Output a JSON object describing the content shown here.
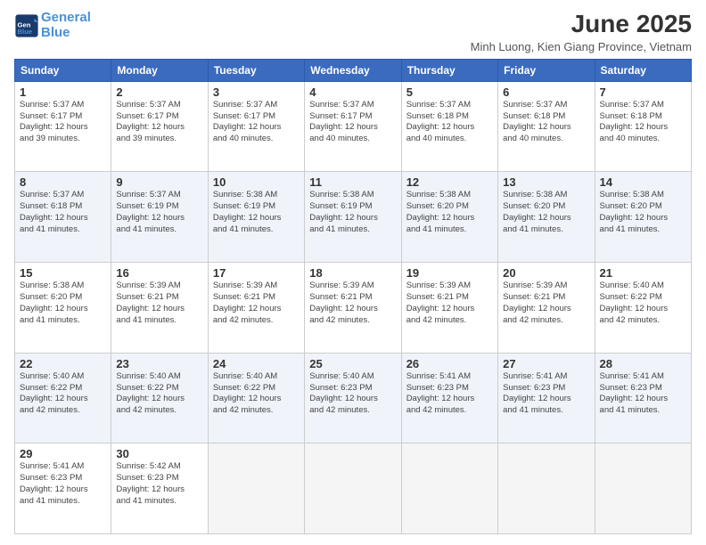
{
  "header": {
    "logo_line1": "General",
    "logo_line2": "Blue",
    "month_title": "June 2025",
    "location": "Minh Luong, Kien Giang Province, Vietnam"
  },
  "weekdays": [
    "Sunday",
    "Monday",
    "Tuesday",
    "Wednesday",
    "Thursday",
    "Friday",
    "Saturday"
  ],
  "weeks": [
    [
      {
        "day": 1,
        "info": "Sunrise: 5:37 AM\nSunset: 6:17 PM\nDaylight: 12 hours\nand 39 minutes."
      },
      {
        "day": 2,
        "info": "Sunrise: 5:37 AM\nSunset: 6:17 PM\nDaylight: 12 hours\nand 39 minutes."
      },
      {
        "day": 3,
        "info": "Sunrise: 5:37 AM\nSunset: 6:17 PM\nDaylight: 12 hours\nand 40 minutes."
      },
      {
        "day": 4,
        "info": "Sunrise: 5:37 AM\nSunset: 6:17 PM\nDaylight: 12 hours\nand 40 minutes."
      },
      {
        "day": 5,
        "info": "Sunrise: 5:37 AM\nSunset: 6:18 PM\nDaylight: 12 hours\nand 40 minutes."
      },
      {
        "day": 6,
        "info": "Sunrise: 5:37 AM\nSunset: 6:18 PM\nDaylight: 12 hours\nand 40 minutes."
      },
      {
        "day": 7,
        "info": "Sunrise: 5:37 AM\nSunset: 6:18 PM\nDaylight: 12 hours\nand 40 minutes."
      }
    ],
    [
      {
        "day": 8,
        "info": "Sunrise: 5:37 AM\nSunset: 6:18 PM\nDaylight: 12 hours\nand 41 minutes."
      },
      {
        "day": 9,
        "info": "Sunrise: 5:37 AM\nSunset: 6:19 PM\nDaylight: 12 hours\nand 41 minutes."
      },
      {
        "day": 10,
        "info": "Sunrise: 5:38 AM\nSunset: 6:19 PM\nDaylight: 12 hours\nand 41 minutes."
      },
      {
        "day": 11,
        "info": "Sunrise: 5:38 AM\nSunset: 6:19 PM\nDaylight: 12 hours\nand 41 minutes."
      },
      {
        "day": 12,
        "info": "Sunrise: 5:38 AM\nSunset: 6:20 PM\nDaylight: 12 hours\nand 41 minutes."
      },
      {
        "day": 13,
        "info": "Sunrise: 5:38 AM\nSunset: 6:20 PM\nDaylight: 12 hours\nand 41 minutes."
      },
      {
        "day": 14,
        "info": "Sunrise: 5:38 AM\nSunset: 6:20 PM\nDaylight: 12 hours\nand 41 minutes."
      }
    ],
    [
      {
        "day": 15,
        "info": "Sunrise: 5:38 AM\nSunset: 6:20 PM\nDaylight: 12 hours\nand 41 minutes."
      },
      {
        "day": 16,
        "info": "Sunrise: 5:39 AM\nSunset: 6:21 PM\nDaylight: 12 hours\nand 41 minutes."
      },
      {
        "day": 17,
        "info": "Sunrise: 5:39 AM\nSunset: 6:21 PM\nDaylight: 12 hours\nand 42 minutes."
      },
      {
        "day": 18,
        "info": "Sunrise: 5:39 AM\nSunset: 6:21 PM\nDaylight: 12 hours\nand 42 minutes."
      },
      {
        "day": 19,
        "info": "Sunrise: 5:39 AM\nSunset: 6:21 PM\nDaylight: 12 hours\nand 42 minutes."
      },
      {
        "day": 20,
        "info": "Sunrise: 5:39 AM\nSunset: 6:21 PM\nDaylight: 12 hours\nand 42 minutes."
      },
      {
        "day": 21,
        "info": "Sunrise: 5:40 AM\nSunset: 6:22 PM\nDaylight: 12 hours\nand 42 minutes."
      }
    ],
    [
      {
        "day": 22,
        "info": "Sunrise: 5:40 AM\nSunset: 6:22 PM\nDaylight: 12 hours\nand 42 minutes."
      },
      {
        "day": 23,
        "info": "Sunrise: 5:40 AM\nSunset: 6:22 PM\nDaylight: 12 hours\nand 42 minutes."
      },
      {
        "day": 24,
        "info": "Sunrise: 5:40 AM\nSunset: 6:22 PM\nDaylight: 12 hours\nand 42 minutes."
      },
      {
        "day": 25,
        "info": "Sunrise: 5:40 AM\nSunset: 6:23 PM\nDaylight: 12 hours\nand 42 minutes."
      },
      {
        "day": 26,
        "info": "Sunrise: 5:41 AM\nSunset: 6:23 PM\nDaylight: 12 hours\nand 42 minutes."
      },
      {
        "day": 27,
        "info": "Sunrise: 5:41 AM\nSunset: 6:23 PM\nDaylight: 12 hours\nand 41 minutes."
      },
      {
        "day": 28,
        "info": "Sunrise: 5:41 AM\nSunset: 6:23 PM\nDaylight: 12 hours\nand 41 minutes."
      }
    ],
    [
      {
        "day": 29,
        "info": "Sunrise: 5:41 AM\nSunset: 6:23 PM\nDaylight: 12 hours\nand 41 minutes."
      },
      {
        "day": 30,
        "info": "Sunrise: 5:42 AM\nSunset: 6:23 PM\nDaylight: 12 hours\nand 41 minutes."
      },
      null,
      null,
      null,
      null,
      null
    ]
  ]
}
